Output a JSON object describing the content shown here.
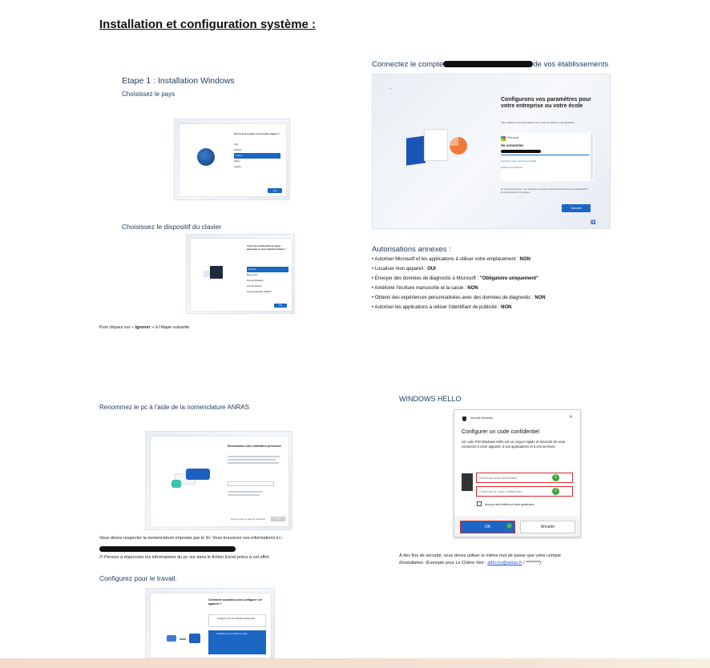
{
  "page_title": "Installation et configuration système :",
  "left_column": {
    "step1_title": "Etape 1 : Installation Windows",
    "step1_sub": "Choisissez le pays",
    "country_dialog": {
      "question": "Est-ce le bon pays ou la bonne région ?",
      "options": [
        "Fidji",
        "Finlande",
        "France",
        "Gabon",
        "Gambie"
      ],
      "selected": "France",
      "button": "Oui"
    },
    "keyboard_title": "Choisissez le dispositif du clavier",
    "keyboard_dialog": {
      "question": "C'est-il de la disposition de clavier appropriée ou de la méthode d'entrée ?",
      "options": [
        "Français",
        "Belge (point)",
        "Français (Belgique)",
        "Français (Suisse)",
        "Français (standard, AZERTY)"
      ],
      "selected": "Français",
      "button": "Oui"
    },
    "ignore_note_prefix": "Puis cliquez sur « ",
    "ignore_note_bold": "Ignorer",
    "ignore_note_suffix": " » à l'étape suivante",
    "rename_title": "Renommez le pc à l'aide de la nomenclature ANRAS",
    "rename_dialog": {
      "heading": "Renommons votre ordinateur personnel",
      "skip": "Ignorer la mise en place de l'ordinateur",
      "next": "Suivant"
    },
    "rename_note": "Vous devez respecter la nomenclature imposée par le SI. Vous trouverez ces informations ici :",
    "warning_note": "/!\\ Pensez à répercuter les informations du pc sur dans le fichier Excel prévu à cet effet.",
    "work_title": "Configurez pour le travail.",
    "work_dialog": {
      "heading": "Comment souhaitez-vous configurer cet appareil ?",
      "option_personal": "Configurer pour une utilisation personnelle",
      "option_work": "Configurer pour le travail ou l'école"
    }
  },
  "right_column": {
    "connect_title_prefix": "Connectez le compte",
    "connect_title_suffix": "de vos établissements",
    "org_dialog": {
      "heading": "Configurons vos paramètres pour votre entreprise ou votre école",
      "subtext": "Vous utiliserez ces informations pour vous connecter à vos appareils.",
      "brand": "Microsoft",
      "signin": "Se connecter",
      "link1": "Connexion avec une clé de sécurité",
      "link2": "Options de connexion",
      "footer": "En choisissant Suivant, vous acceptez le Contrat de services Microsoft ainsi que la déclaration de confidentialité et les cookies.",
      "next": "Suivant"
    },
    "annex_title": "Autorisations annexes :",
    "annex_items": [
      {
        "text": "• Autoriser Microsoft et les applications à utiliser votre emplacement : ",
        "value": "NON"
      },
      {
        "text": "• Localiser mon appareil : ",
        "value": "OUI"
      },
      {
        "text": "• Envoyer des données de diagnostic à Microsoft : ",
        "value": "\"Obligatoire uniquement\""
      },
      {
        "text": "• Améliorer l'écriture manuscrite et la saisie : ",
        "value": "NON"
      },
      {
        "text": "• Obtenir des expériences personnalisées avec des données de diagnostic : ",
        "value": "NON"
      },
      {
        "text": "• Autoriser les applications à utiliser l'identifiant de publicité : ",
        "value": "NON"
      }
    ],
    "hello_title": "WINDOWS HELLO",
    "hello_dialog": {
      "window_title": "Sécurité Windows",
      "close": "×",
      "heading": "Configurer un code confidentiel",
      "description": "Un code PIN Windows Hello est un moyen rapide et sécurisé de vous connecter à votre appareil, à vos applications et à vos services.",
      "new_pin": "Nouveau code confidentiel",
      "confirm_pin": "Confirmer le code confidentiel",
      "checkbox": "Inclure des lettres et des symboles",
      "ok": "OK",
      "cancel": "Annuler",
      "marker1": "1",
      "marker2": "2",
      "marker3": "3"
    },
    "hello_note_line1": "À des fins de sécurité, vous devez utiliser le même mot de passe que votre compte",
    "hello_note_prefix": "d'installation. (Exemple pour Le Chêne Vert : ",
    "hello_note_link": "adm.lcv@anras.fr",
    "hello_note_suffix": " / ********)"
  },
  "colors": {
    "accent_blue": "#1a67c4",
    "title_navy": "#1f3a5c",
    "highlight_red": "#e0262b",
    "marker_green": "#3aa53a"
  }
}
